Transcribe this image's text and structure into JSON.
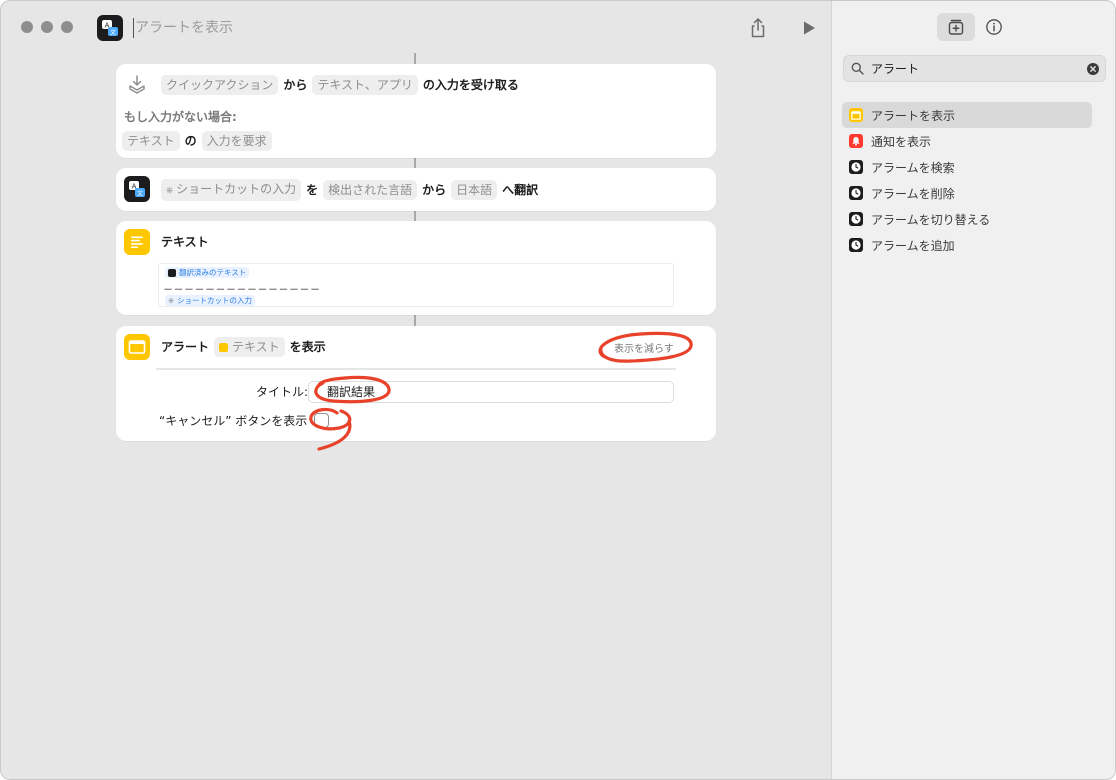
{
  "window": {
    "title_placeholder": "アラートを表示"
  },
  "actions": {
    "receive": {
      "token_source": "クイックアクション",
      "text_from": "から",
      "token_types": "テキスト、アプリ",
      "text_receive": "の入力を受け取る",
      "if_none_label": "もし入力がない場合:",
      "token_fallback": "テキスト",
      "text_of": "の",
      "token_request": "入力を要求"
    },
    "translate": {
      "token_input": "ショートカットの入力",
      "text_wo": "を",
      "token_detected": "検出された言語",
      "text_from": "から",
      "token_lang": "日本語",
      "text_to": "へ翻訳"
    },
    "text": {
      "title": "テキスト",
      "var_translated": "翻訳済みのテキスト",
      "dashes": "－－－－－－－－－－－－－－－",
      "var_input": "ショートカットの入力"
    },
    "alert": {
      "text_alert": "アラート",
      "token_text": "テキスト",
      "text_show": "を表示",
      "show_less": "表示を減らす",
      "title_label": "タイトル:",
      "title_value": "翻訳結果",
      "cancel_label": "“キャンセル” ボタンを表示"
    }
  },
  "sidebar": {
    "search_value": "アラート",
    "results": [
      {
        "label": "アラートを表示",
        "icon": "alert-window-icon"
      },
      {
        "label": "通知を表示",
        "icon": "bell-icon"
      },
      {
        "label": "アラームを検索",
        "icon": "alarm-clock-icon"
      },
      {
        "label": "アラームを削除",
        "icon": "alarm-clock-icon"
      },
      {
        "label": "アラームを切り替える",
        "icon": "alarm-clock-icon"
      },
      {
        "label": "アラームを追加",
        "icon": "alarm-clock-icon"
      }
    ]
  },
  "colors": {
    "accent_yellow": "#ffc700",
    "annotation_red": "#e8432a",
    "notification_red": "#ff3b30",
    "variable_blue": "#2b7fe6"
  }
}
